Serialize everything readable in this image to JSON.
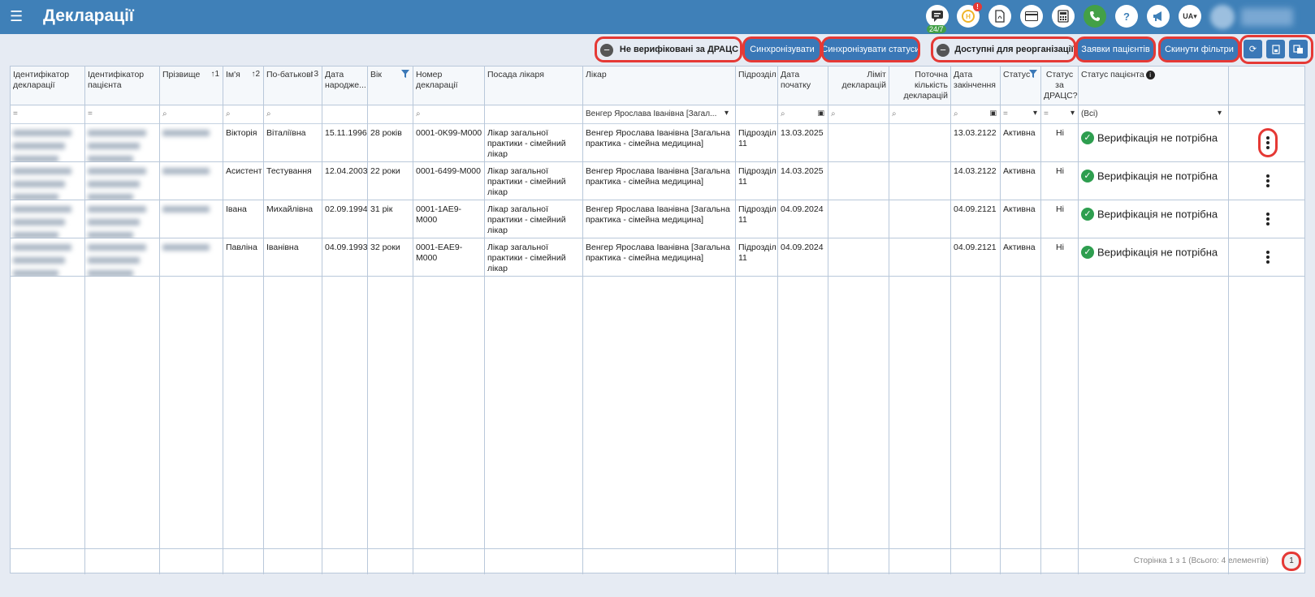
{
  "header": {
    "title": "Декларації",
    "support_badge": "24/7",
    "notif_count": "!",
    "lang": "UA"
  },
  "toolbar": {
    "unverified_label": "Не верифіковані за ДРАЦС",
    "sync_btn": "Синхронізувати",
    "sync_status_btn": "Синхронізувати статуси",
    "reorg_label": "Доступні для реорганізації",
    "requests_btn": "Заявки пацієнтів",
    "reset_btn": "Скинути фільтри"
  },
  "columns": [
    {
      "label": "Ідентифікатор декларації"
    },
    {
      "label": "Ідентифікатор пацієнта"
    },
    {
      "label": "Прізвище",
      "sort": "1"
    },
    {
      "label": "Ім'я",
      "sort": "2"
    },
    {
      "label": "По-батькові",
      "sort": "3"
    },
    {
      "label": "Дата народже..."
    },
    {
      "label": "Вік"
    },
    {
      "label": "Номер декларації"
    },
    {
      "label": "Посада лікаря"
    },
    {
      "label": "Лікар"
    },
    {
      "label": "Підрозділ"
    },
    {
      "label": "Дата початку"
    },
    {
      "label": "Ліміт декларацій"
    },
    {
      "label": "Поточна кількість декларацій"
    },
    {
      "label": "Дата закінчення"
    },
    {
      "label": "Статус"
    },
    {
      "label": "Статус за ДРАЦС?"
    },
    {
      "label": "Статус пацієнта"
    },
    {
      "label": ""
    }
  ],
  "filters": {
    "eq": "=",
    "doctor": "Венгер Ярослава Іванівна [Загал...",
    "all": "(Всі)"
  },
  "rows": [
    {
      "first": "Вікторія",
      "middle": "Віталіївна",
      "birth": "15.11.1996",
      "age": "28 років",
      "decl_no": "0001-0K99-M000",
      "position": "Лікар загальної практики - сімейний лікар",
      "doctor": "Венгер Ярослава Іванівна [Загальна практика - сімейна медицина]",
      "unit": "Підрозділ 11",
      "start": "13.03.2025",
      "end": "13.03.2122",
      "status": "Активна",
      "drac": "Ні",
      "patient_status": "Верифікація не потрібна"
    },
    {
      "first": "Асистент",
      "middle": "Тестування",
      "birth": "12.04.2003",
      "age": "22 роки",
      "decl_no": "0001-6499-M000",
      "position": "Лікар загальної практики - сімейний лікар",
      "doctor": "Венгер Ярослава Іванівна [Загальна практика - сімейна медицина]",
      "unit": "Підрозділ 11",
      "start": "14.03.2025",
      "end": "14.03.2122",
      "status": "Активна",
      "drac": "Ні",
      "patient_status": "Верифікація не потрібна"
    },
    {
      "first": "Івана",
      "middle": "Михайлівна",
      "birth": "02.09.1994",
      "age": "31 рік",
      "decl_no": "0001-1AE9-M000",
      "position": "Лікар загальної практики - сімейний лікар",
      "doctor": "Венгер Ярослава Іванівна [Загальна практика - сімейна медицина]",
      "unit": "Підрозділ 11",
      "start": "04.09.2024",
      "end": "04.09.2121",
      "status": "Активна",
      "drac": "Ні",
      "patient_status": "Верифікація не потрібна"
    },
    {
      "first": "Павліна",
      "middle": "Іванівна",
      "birth": "04.09.1993",
      "age": "32 роки",
      "decl_no": "0001-EAE9-M000",
      "position": "Лікар загальної практики - сімейний лікар",
      "doctor": "Венгер Ярослава Іванівна [Загальна практика - сімейна медицина]",
      "unit": "Підрозділ 11",
      "start": "04.09.2024",
      "end": "04.09.2121",
      "status": "Активна",
      "drac": "Ні",
      "patient_status": "Верифікація не потрібна"
    }
  ],
  "footer": {
    "page_info": "Сторінка 1 з 1 (Всього: 4 елементів)",
    "page": "1"
  },
  "colors": {
    "primary": "#3a78b7",
    "highlight": "#e53935",
    "success": "#2e9e4f"
  }
}
